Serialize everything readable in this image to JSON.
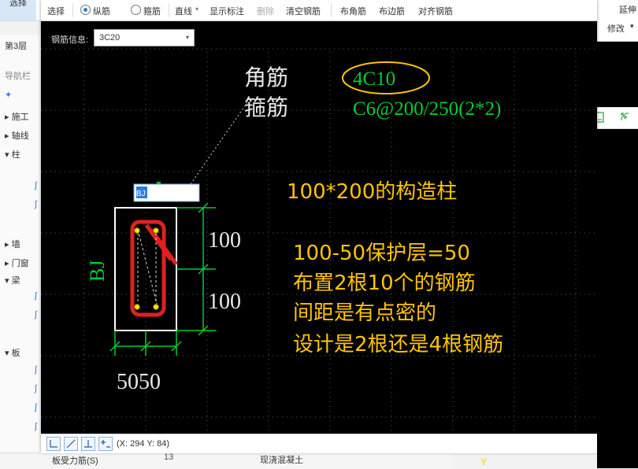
{
  "background": {
    "ribbon_select_label": "选择",
    "left_panel": {
      "floor_tab": "第3层",
      "nav_label": "导航栏",
      "items": [
        "施工",
        "轴线",
        "柱",
        "墙",
        "门窗",
        "梁",
        "板"
      ]
    },
    "right_panel": {
      "top_label": "延伸",
      "modify_label": "修改"
    },
    "bottom": {
      "row_number": "13",
      "cell_left": "板受力筋(S)",
      "cell_right": "现浇混凝土"
    },
    "right_black_label": "Y"
  },
  "toolbar": {
    "select_label": "选择",
    "radio_longitudinal": "纵筋",
    "radio_stirrup": "箍筋",
    "line_label": "直线",
    "show_annotation": "显示标注",
    "delete_label": "删除",
    "clear_rebar": "清空钢筋",
    "corner_rebar": "布角筋",
    "side_rebar": "布边筋",
    "align_rebar": "对齐钢筋"
  },
  "info": {
    "label": "钢筋信息:",
    "value": "3C20"
  },
  "drawing": {
    "callout_corner": "角筋",
    "callout_stirrup": "箍筋",
    "corner_spec": "4C10",
    "stirrup_spec": "C6@200/250(2*2)",
    "input_box_value": "BJ",
    "side_label": "BJ",
    "dim_top": "100",
    "dim_bottom": "100",
    "dim_width": "5050",
    "notes": [
      "100*200的构造柱",
      "100-50保护层=50",
      "布置2根10个的钢筋",
      "间距是有点密的",
      "设计是2根还是4根钢筋"
    ],
    "colors": {
      "background": "#000000",
      "grid": "#5a5a5a",
      "dimension_green": "#00cc33",
      "rebar_red": "#e02020",
      "note_yellow": "#ffc400",
      "outline_white": "#ffffff"
    }
  },
  "status": {
    "coords": "(X: 294 Y: 84)"
  }
}
